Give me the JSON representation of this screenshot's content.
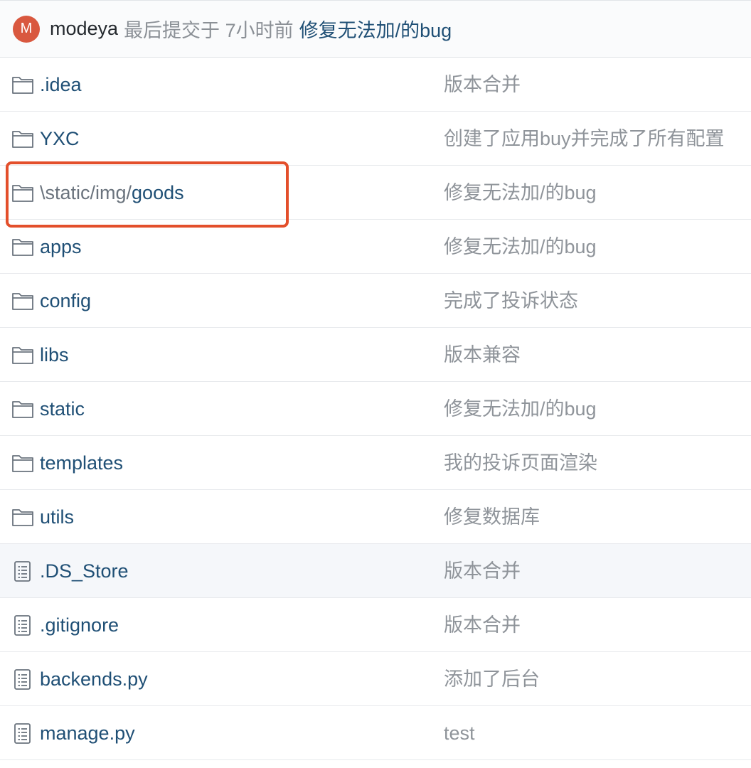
{
  "commit": {
    "avatar_letter": "M",
    "author": "modeya",
    "meta": "最后提交于 7小时前",
    "message": "修复无法加/的bug"
  },
  "rows": [
    {
      "type": "folder",
      "name": ".idea",
      "commit": "版本合并"
    },
    {
      "type": "folder",
      "name": "YXC",
      "commit": "创建了应用buy并完成了所有配置"
    },
    {
      "type": "folder",
      "prefix": "\\static/img/",
      "name": "goods",
      "commit": "修复无法加/的bug"
    },
    {
      "type": "folder",
      "name": "apps",
      "commit": "修复无法加/的bug"
    },
    {
      "type": "folder",
      "name": "config",
      "commit": "完成了投诉状态"
    },
    {
      "type": "folder",
      "name": "libs",
      "commit": "版本兼容"
    },
    {
      "type": "folder",
      "name": "static",
      "commit": "修复无法加/的bug"
    },
    {
      "type": "folder",
      "name": "templates",
      "commit": "我的投诉页面渲染"
    },
    {
      "type": "folder",
      "name": "utils",
      "commit": "修复数据库"
    },
    {
      "type": "file",
      "name": ".DS_Store",
      "commit": "版本合并"
    },
    {
      "type": "file",
      "name": ".gitignore",
      "commit": "版本合并"
    },
    {
      "type": "file",
      "name": "backends.py",
      "commit": "添加了后台"
    },
    {
      "type": "file",
      "name": "manage.py",
      "commit": "test"
    }
  ],
  "highlighted_row": 9,
  "annotated_row": 2,
  "icons": {
    "folder": "folder-icon",
    "file": "file-icon"
  },
  "colors": {
    "link": "#1f4f75",
    "muted": "#8f949a",
    "avatar": "#d9583f",
    "annotation": "#e34f2b"
  }
}
